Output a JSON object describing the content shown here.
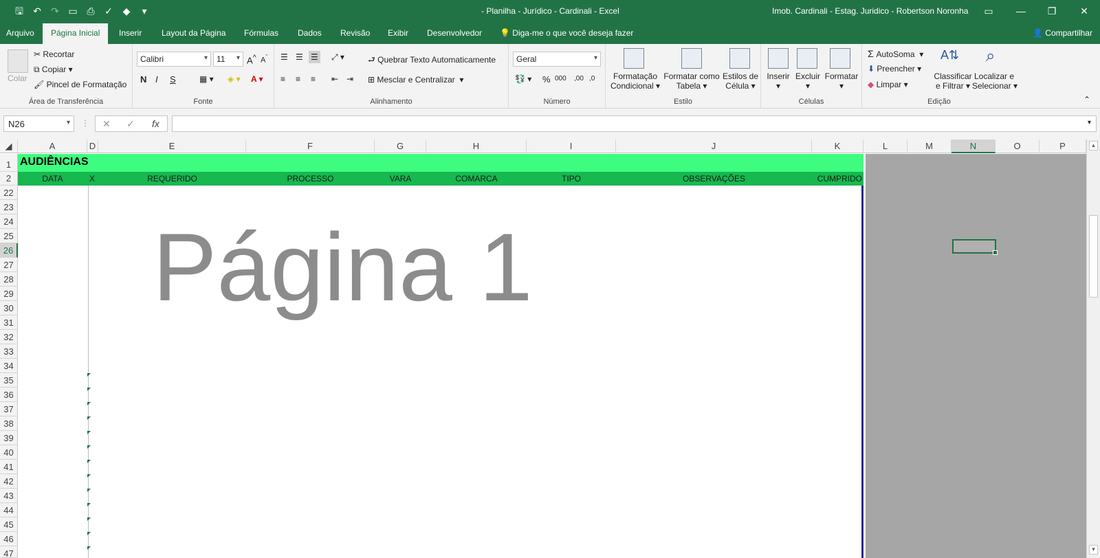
{
  "titlebar": {
    "title": "- Planilha - Jurídico - Cardinali - Excel",
    "account": "Imob. Cardinali - Estag. Juridico - Robertson Noronha"
  },
  "tabs": {
    "items": [
      "Arquivo",
      "Página Inicial",
      "Inserir",
      "Layout da Página",
      "Fórmulas",
      "Dados",
      "Revisão",
      "Exibir",
      "Desenvolvedor"
    ],
    "active": "Página Inicial",
    "tellme": "Diga-me o que você deseja fazer",
    "share": "Compartilhar"
  },
  "ribbon": {
    "clipboard": {
      "paste": "Colar",
      "cut": "Recortar",
      "copy": "Copiar",
      "format_painter": "Pincel de Formatação",
      "label": "Área de Transferência"
    },
    "font": {
      "name": "Calibri",
      "size": "11",
      "bold": "N",
      "italic": "I",
      "underline": "S",
      "label": "Fonte"
    },
    "alignment": {
      "wrap": "Quebrar Texto Automaticamente",
      "merge": "Mesclar e Centralizar",
      "label": "Alinhamento"
    },
    "number": {
      "format": "Geral",
      "label": "Número"
    },
    "styles": {
      "conditional": [
        "Formatação",
        "Condicional"
      ],
      "table": [
        "Formatar como",
        "Tabela"
      ],
      "cell": [
        "Estilos de",
        "Célula"
      ],
      "label": "Estilo"
    },
    "cells": {
      "insert": "Inserir",
      "delete": "Excluir",
      "format": "Formatar",
      "label": "Células"
    },
    "editing": {
      "autosum": "AutoSoma",
      "fill": "Preencher",
      "clear": "Limpar",
      "sort": [
        "Classificar",
        "e Filtrar"
      ],
      "find": [
        "Localizar e",
        "Selecionar"
      ],
      "label": "Edição"
    }
  },
  "formula_bar": {
    "name_box": "N26",
    "formula": ""
  },
  "sheet": {
    "columns": [
      "A",
      "D",
      "E",
      "F",
      "G",
      "H",
      "I",
      "J",
      "K",
      "L",
      "M",
      "N",
      "O",
      "P"
    ],
    "selected_column": "N",
    "rows": [
      "1",
      "2",
      "22",
      "23",
      "24",
      "25",
      "26",
      "27",
      "28",
      "29",
      "30",
      "31",
      "32",
      "33",
      "34",
      "35",
      "36",
      "37",
      "38",
      "39",
      "40",
      "41",
      "42",
      "43",
      "44",
      "45",
      "46",
      "47"
    ],
    "selected_row": "26",
    "title_cell": "AUDIÊNCIAS",
    "headers": [
      "DATA",
      "X",
      "REQUERIDO",
      "PROCESSO",
      "VARA",
      "COMARCA",
      "TIPO",
      "OBSERVAÇÕES",
      "CUMPRIDO"
    ],
    "watermark": "Página 1"
  }
}
